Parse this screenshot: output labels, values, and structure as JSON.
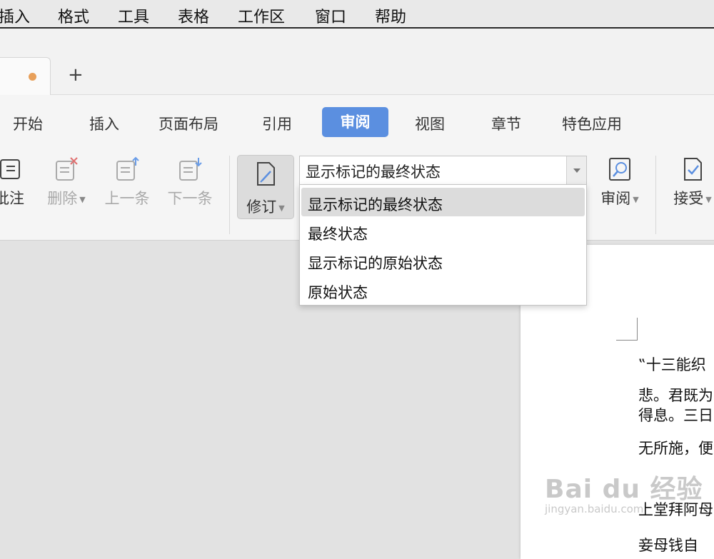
{
  "menubar": {
    "items": [
      "插入",
      "格式",
      "工具",
      "表格",
      "工作区",
      "窗口",
      "帮助"
    ]
  },
  "tabstrip": {
    "new_tab_glyph": "+",
    "unsaved_dot_color": "#e8a05a"
  },
  "ribbon": {
    "tabs": [
      "开始",
      "插入",
      "页面布局",
      "引用",
      "审阅",
      "视图",
      "章节",
      "特色应用"
    ],
    "active_tab": "审阅",
    "accent": "#5b8fe0",
    "tools": {
      "comment": "批注",
      "delete": "删除",
      "prev": "上一条",
      "next": "下一条",
      "track": "修订",
      "review": "审阅",
      "accept": "接受"
    },
    "display_combo": {
      "value": "显示标记的最终状态"
    }
  },
  "dropdown": {
    "options": [
      "显示标记的最终状态",
      "最终状态",
      "显示标记的原始状态",
      "原始状态"
    ],
    "selected": "显示标记的最终状态"
  },
  "document": {
    "lines": [
      "‟十三能织",
      "悲。君既为",
      "得息。三日",
      "无所施，便",
      "上堂拜阿母",
      "妾母钱自"
    ]
  },
  "watermark": {
    "logo": "Bai du 经验",
    "url": "jingyan.baidu.com"
  }
}
